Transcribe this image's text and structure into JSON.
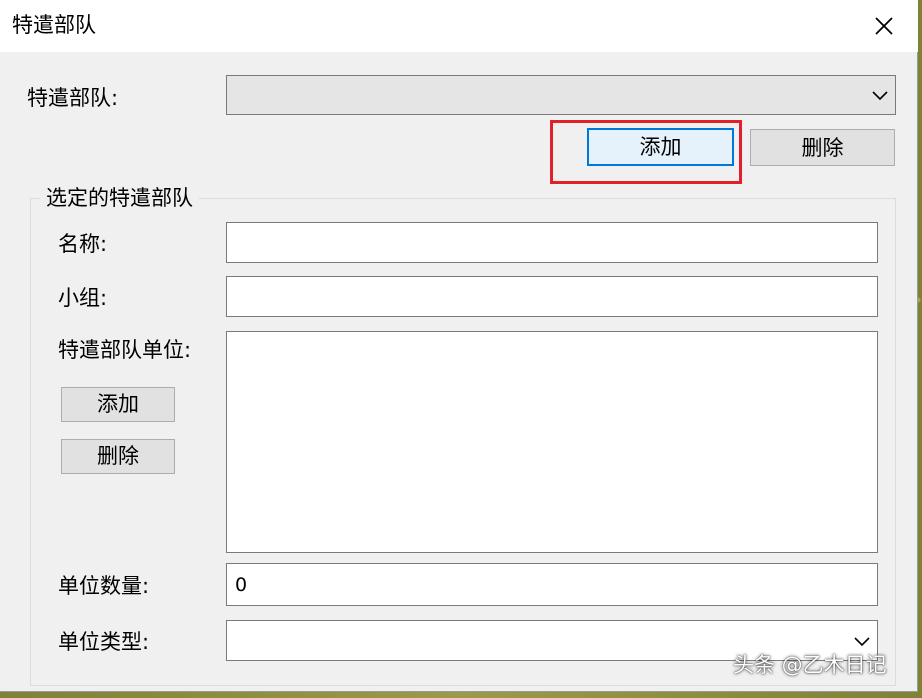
{
  "window": {
    "title": "特遣部队"
  },
  "top_section": {
    "task_force_label": "特遣部队:",
    "task_force_value": "",
    "add_button": "添加",
    "delete_button": "删除"
  },
  "selected_group": {
    "title": "选定的特遣部队",
    "name_label": "名称:",
    "name_value": "",
    "team_label": "小组:",
    "team_value": "",
    "units_label": "特遣部队单位:",
    "units_items": [],
    "add_unit_button": "添加",
    "delete_unit_button": "删除",
    "unit_count_label": "单位数量:",
    "unit_count_value": "0",
    "unit_type_label": "单位类型:",
    "unit_type_value": ""
  },
  "watermark": "头条 @乙木日记",
  "colors": {
    "highlight": "#e0202a",
    "focus": "#0078d7",
    "dialog_bg": "#f0f0f0"
  },
  "icons": {
    "close": "close-icon",
    "dropdown": "chevron-down-icon"
  }
}
